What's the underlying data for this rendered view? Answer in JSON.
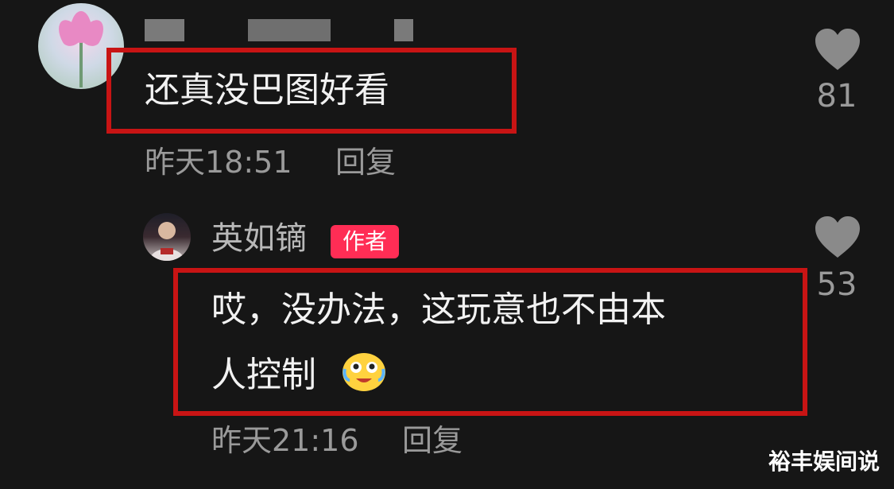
{
  "comment": {
    "text": "还真没巴图好看",
    "time": "昨天18:51",
    "reply_label": "回复",
    "likes": "81"
  },
  "reply": {
    "author": "英如镝",
    "badge": "作者",
    "text_line1": "哎，没办法，这玩意也不由本",
    "text_line2": "人控制",
    "emoji": "crying-laughing-emoji",
    "time": "昨天21:16",
    "reply_label": "回复",
    "likes": "53"
  },
  "watermark": "裕丰娱间说",
  "colors": {
    "background": "#161616",
    "highlight_box": "#c81414",
    "author_badge": "#ff2d55",
    "secondary_text": "#9a9a9a"
  },
  "icons": {
    "like": "heart-icon",
    "avatar_main": "lotus-avatar",
    "avatar_reply": "person-avatar"
  }
}
